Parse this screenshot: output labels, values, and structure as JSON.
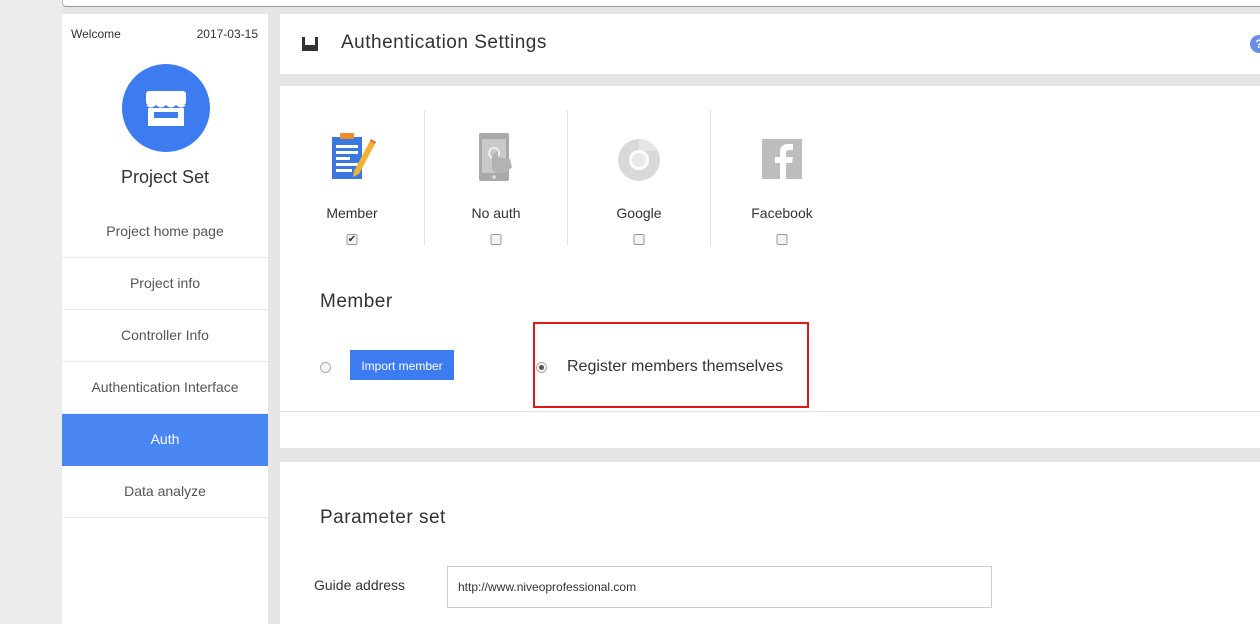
{
  "sidebar": {
    "welcome": "Welcome",
    "date": "2017-03-15",
    "project_title": "Project Set",
    "items": [
      {
        "label": "Project home page"
      },
      {
        "label": "Project info"
      },
      {
        "label": "Controller Info"
      },
      {
        "label": "Authentication Interface"
      },
      {
        "label": "Auth",
        "active": true
      },
      {
        "label": "Data analyze"
      }
    ]
  },
  "header": {
    "title": "Authentication Settings",
    "help": "?"
  },
  "auth_options": [
    {
      "label": "Member",
      "checked": true,
      "icon": "member-clipboard-icon"
    },
    {
      "label": "No auth",
      "checked": false,
      "icon": "phone-touch-icon"
    },
    {
      "label": "Google",
      "checked": false,
      "icon": "chrome-icon"
    },
    {
      "label": "Facebook",
      "checked": false,
      "icon": "facebook-icon"
    }
  ],
  "member": {
    "title": "Member",
    "import_button": "Import member",
    "register_label": "Register members themselves",
    "selected": "register"
  },
  "parameters": {
    "title": "Parameter set",
    "guide_label": "Guide address",
    "guide_value": "http://www.niveoprofessional.com"
  },
  "colors": {
    "accent": "#4a86f4",
    "highlight": "#e01818"
  }
}
